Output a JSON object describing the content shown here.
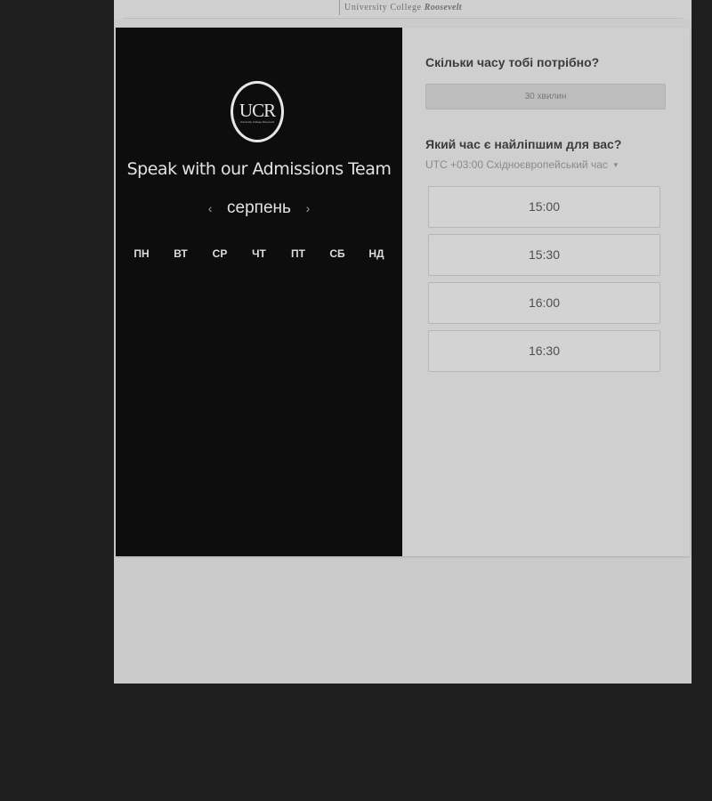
{
  "header": {
    "logo_text_1": "University College",
    "logo_text_2": "Roosevelt"
  },
  "left_panel": {
    "logo_letters": "UCR",
    "logo_small_text": "University College Roosevelt",
    "title": "Speak with our Admissions Team",
    "month_label": "серпень",
    "prev_icon": "chevron-left-icon",
    "next_icon": "chevron-right-icon",
    "weekdays": [
      "ПН",
      "ВТ",
      "СР",
      "ЧТ",
      "ПТ",
      "СБ",
      "НД"
    ]
  },
  "right_panel": {
    "duration_question": "Скільки часу тобі потрібно?",
    "duration_value": "30 хвилин",
    "time_question": "Який час є найліпшим для вас?",
    "timezone_label": "UTC +03:00 Східноєвропейський час",
    "caret_icon": "caret-down-icon",
    "time_slots": [
      "15:00",
      "15:30",
      "16:00",
      "16:30"
    ]
  },
  "colors": {
    "background": "#1f1f1f",
    "left_panel": "#0d0d0d",
    "right_panel": "#cfcfcf"
  }
}
